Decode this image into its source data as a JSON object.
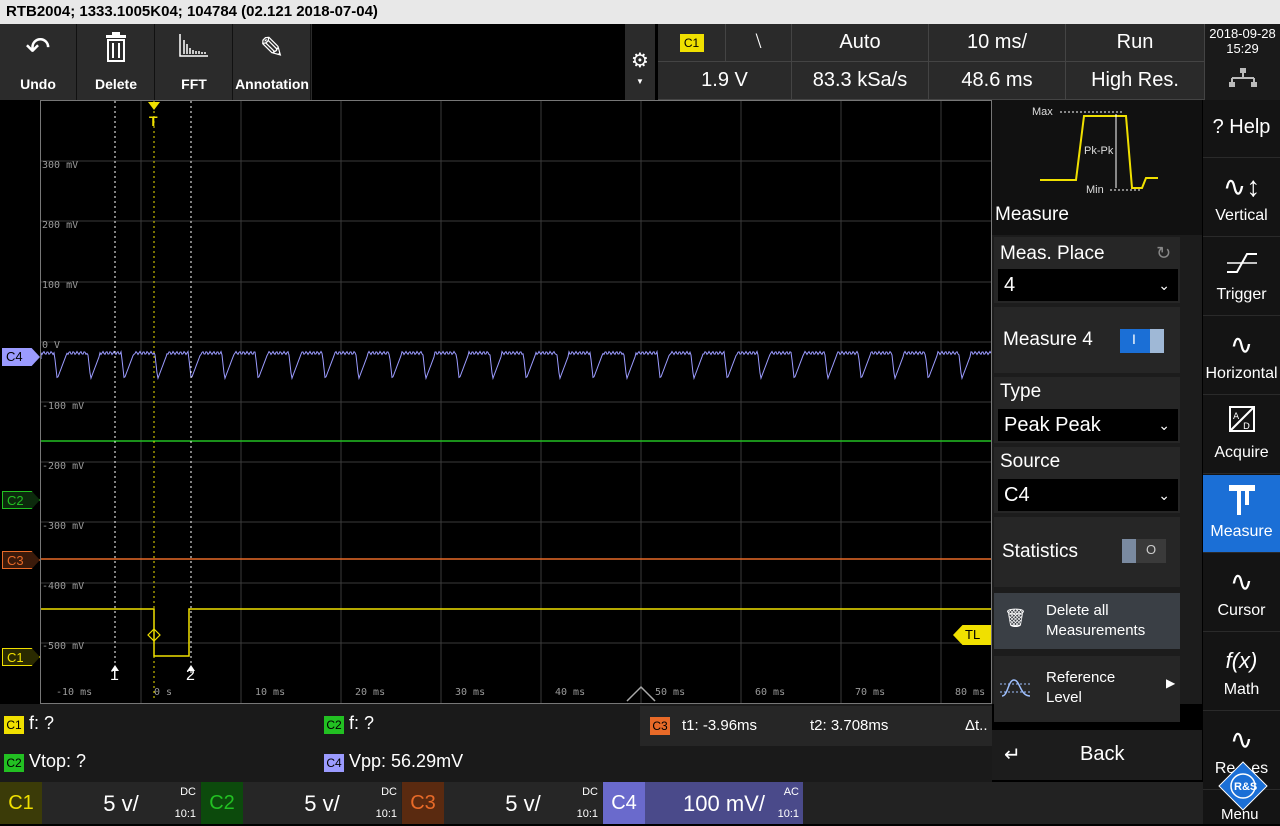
{
  "title_bar": {
    "text": "RTB2004; 1333.1005K04; 104784 (02.121 2018-07-04)"
  },
  "toolbar": {
    "undo": "Undo",
    "delete": "Delete",
    "fft": "FFT",
    "annotation": "Annotation"
  },
  "status": {
    "trigger_channel": "C1",
    "trigger_slope": "⧵",
    "trigger_mode": "Auto",
    "timebase": "10 ms/",
    "run_state": "Run",
    "trigger_level": "1.9 V",
    "sample_rate": "83.3 kSa/s",
    "time_offset": "48.6 ms",
    "acq_mode": "High Res."
  },
  "clock": {
    "date": "2018-09-28",
    "time": "15:29"
  },
  "scope": {
    "trigger_marker": "T",
    "tl_marker": "TL",
    "cursor1": "1",
    "cursor2": "2",
    "y_labels": [
      "300 mV",
      "200 mV",
      "100 mV",
      "0 V",
      "-100 mV",
      "-200 mV",
      "-300 mV",
      "-400 mV",
      "-500 mV"
    ],
    "x_labels": [
      "-10 ms",
      "0 s",
      "10 ms",
      "20 ms",
      "30 ms",
      "40 ms",
      "50 ms",
      "60 ms",
      "70 ms",
      "80 ms"
    ],
    "channel_markers": {
      "c4": "C4",
      "c2": "C2",
      "c3": "C3",
      "c1": "C1"
    }
  },
  "measure_panel": {
    "illustration": {
      "max": "Max",
      "pkpk": "Pk-Pk",
      "min": "Min"
    },
    "title": "Measure",
    "meas_place_label": "Meas. Place",
    "meas_place_value": "4",
    "measure4_label": "Measure 4",
    "measure4_on": "I",
    "type_label": "Type",
    "type_value": "Peak Peak",
    "source_label": "Source",
    "source_value": "C4",
    "statistics_label": "Statistics",
    "delete_all": "Delete all Measurements",
    "reference_level": "Reference Level",
    "back": "Back"
  },
  "sidebar": {
    "help": "Help",
    "vertical": "Vertical",
    "trigger": "Trigger",
    "horizontal": "Horizontal",
    "acquire": "Acquire",
    "measure": "Measure",
    "cursor": "Cursor",
    "math": "Math",
    "references": "Re",
    "references_tail": "es",
    "menu": "Menu"
  },
  "measurements": {
    "m1_tag": "C1",
    "m1_text": "f: ?",
    "m2_tag": "C2",
    "m2_text": "f: ?",
    "m3_tag": "C2",
    "m3_text": "Vtop: ?",
    "m4_tag": "C4",
    "m4_text": "Vpp: 56.29mV",
    "cursor_tag": "C3",
    "t1": "t1: -3.96ms",
    "t2": "t2: 3.708ms",
    "dt": "Δt.."
  },
  "channels": [
    {
      "name": "C1",
      "scale": "5 v/",
      "coupling": "DC",
      "probe": "10:1"
    },
    {
      "name": "C2",
      "scale": "5 v/",
      "coupling": "DC",
      "probe": "10:1"
    },
    {
      "name": "C3",
      "scale": "5 v/",
      "coupling": "DC",
      "probe": "10:1"
    },
    {
      "name": "C4",
      "scale": "100 mV/",
      "coupling": "AC",
      "probe": "10:1"
    }
  ],
  "colors": {
    "c1": "#f0e000",
    "c2": "#22c022",
    "c3": "#e86a28",
    "c4": "#9b9bff",
    "accent": "#1b6fd6"
  }
}
